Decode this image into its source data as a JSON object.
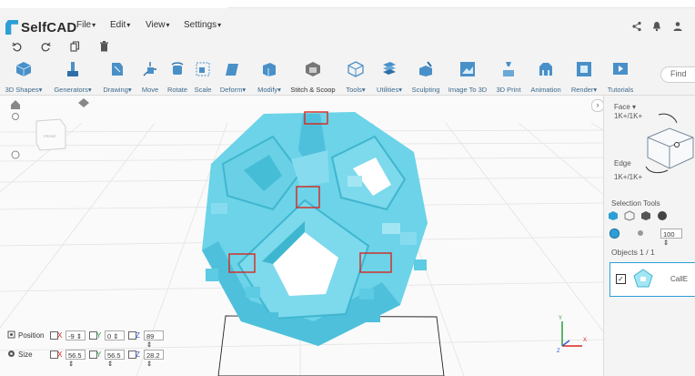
{
  "app": {
    "name": "SelfCAD"
  },
  "menu": [
    "File",
    "Edit",
    "View",
    "Settings"
  ],
  "toolbar": [
    {
      "label": "3D Shapes",
      "dropdown": true
    },
    {
      "label": "Generators",
      "dropdown": true
    },
    {
      "label": "Drawing",
      "dropdown": true
    },
    {
      "label": "Move",
      "dropdown": false
    },
    {
      "label": "Rotate",
      "dropdown": false
    },
    {
      "label": "Scale",
      "dropdown": false
    },
    {
      "label": "Deform",
      "dropdown": true
    },
    {
      "label": "Modify",
      "dropdown": true
    },
    {
      "label": "Stitch & Scoop",
      "dropdown": false
    },
    {
      "label": "Tools",
      "dropdown": true
    },
    {
      "label": "Utilities",
      "dropdown": true
    },
    {
      "label": "Sculpting",
      "dropdown": false
    },
    {
      "label": "Image To 3D",
      "dropdown": false
    },
    {
      "label": "3D Print",
      "dropdown": false
    },
    {
      "label": "Animation",
      "dropdown": false
    },
    {
      "label": "Render",
      "dropdown": true
    },
    {
      "label": "Tutorials",
      "dropdown": false
    }
  ],
  "search": {
    "placeholder": "Find"
  },
  "panel": {
    "face_label": "Face",
    "face_shortcut": "1K+/1K+",
    "edge_label": "Edge",
    "edge_shortcut": "1K+/1K+",
    "selection_tools_label": "Selection Tools",
    "brush_size": "100",
    "objects_label": "Objects 1 / 1",
    "object_name": "CallE"
  },
  "transform": {
    "position_label": "Position",
    "size_label": "Size",
    "position": {
      "x": "-9",
      "y": "0",
      "z": "89"
    },
    "size": {
      "x": "56.5",
      "y": "56.5",
      "z": "28.2"
    }
  },
  "cube_face_label": "FRONT",
  "colors": {
    "model": "#6cd3e8",
    "model_shadow": "#3fb6cf",
    "highlight": "#d7261e",
    "toolbar_icon": "#4a90c8",
    "axis_x": "#d7261e",
    "axis_y": "#2a9d3a",
    "axis_z": "#3a5bd6"
  }
}
